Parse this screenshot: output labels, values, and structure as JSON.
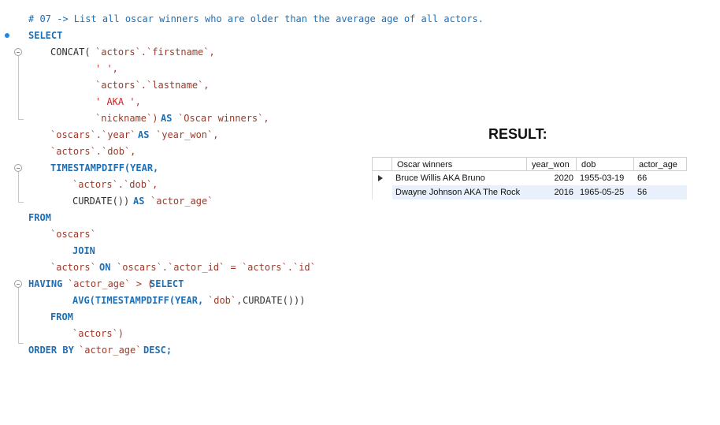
{
  "editor": {
    "comment": "# 07 -> List all oscar winners who are older than the average age of all actors.",
    "lines": [
      {
        "t": "comment"
      },
      {
        "t": "code"
      }
    ],
    "kw_select": "SELECT",
    "fn_concat": "CONCAT(",
    "id_actors_firstname": "`actors`.`firstname`,",
    "str_space": "' ',",
    "id_actors_lastname": "`actors`.`lastname`,",
    "str_aka": "' AKA ',",
    "id_nickname": "`nickname`)",
    "kw_as1": "AS",
    "id_oscar_winners": "`Oscar winners`,",
    "id_oscars_year": "`oscars`.`year`",
    "kw_as2": "AS",
    "id_year_won": "`year_won`,",
    "id_actors_dob": "`actors`.`dob`,",
    "fn_timestampdiff": "TIMESTAMPDIFF(YEAR,",
    "id_actors_dob2": "`actors`.`dob`,",
    "fn_curdate": "CURDATE())",
    "kw_as3": "AS",
    "id_actor_age": "`actor_age`",
    "kw_from": "FROM",
    "id_oscars": "`oscars`",
    "kw_join": "JOIN",
    "id_actors_on": "`actors`",
    "kw_on": "ON",
    "id_on_expr": "`oscars`.`actor_id` = `actors`.`id`",
    "kw_having": "HAVING",
    "id_having_age": "`actor_age` > (",
    "kw_select2": "SELECT",
    "fn_avg": "AVG(TIMESTAMPDIFF(YEAR,",
    "id_dob": "`dob`,",
    "fn_curdate2": "CURDATE()))",
    "kw_from2": "FROM",
    "id_actors_close": "`actors`)",
    "kw_order": "ORDER BY",
    "id_order_age": "`actor_age`",
    "kw_desc": "DESC;"
  },
  "result": {
    "title": "RESULT:",
    "columns": [
      "Oscar winners",
      "year_won",
      "dob",
      "actor_age"
    ],
    "rows": [
      {
        "name": "Bruce Willis AKA Bruno",
        "year_won": "2020",
        "dob": "1955-03-19",
        "actor_age": "66"
      },
      {
        "name": "Dwayne Johnson AKA The Rock",
        "year_won": "2016",
        "dob": "1965-05-25",
        "actor_age": "56"
      }
    ]
  },
  "colors": {
    "keyword": "#1f6fb5",
    "identifier": "#9b3a2a",
    "string": "#c62828",
    "selected_row": "#e8f0fb"
  }
}
